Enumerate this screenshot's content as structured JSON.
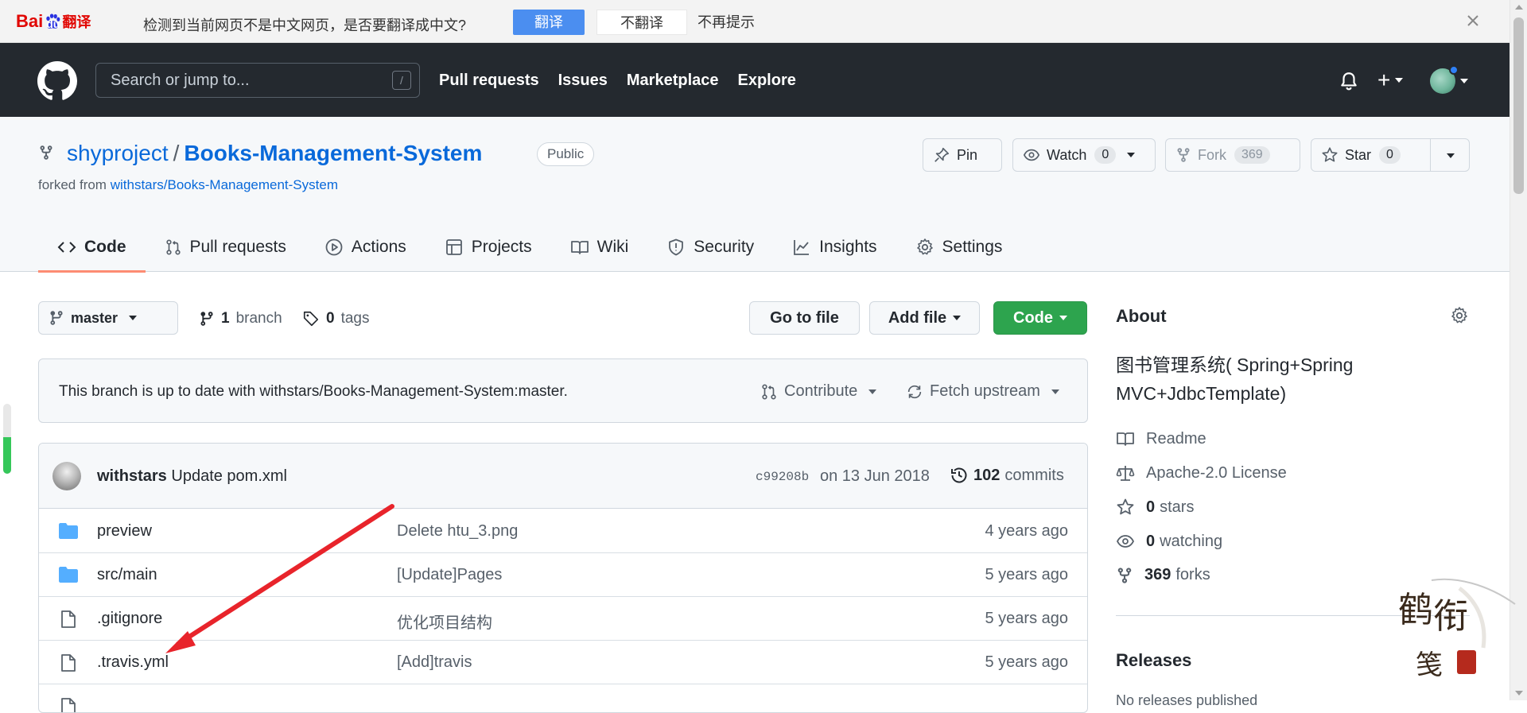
{
  "baidu_bar": {
    "logo_text": "Bai",
    "logo_text2": "du",
    "logo_suffix": "翻译",
    "message": "检测到当前网页不是中文网页，是否要翻译成中文?",
    "translate_label": "翻译",
    "no_translate_label": "不翻译",
    "never_label": "不再提示",
    "accent_color": "#4b8ef0",
    "brand_color": "#e10602"
  },
  "github_header": {
    "search_placeholder": "Search or jump to...",
    "search_shortcut": "/",
    "nav": [
      "Pull requests",
      "Issues",
      "Marketplace",
      "Explore"
    ],
    "plus_label": "+",
    "background_color": "#24292f"
  },
  "repo": {
    "owner": "shyproject",
    "separator": "/",
    "name": "Books-Management-System",
    "visibility": "Public",
    "forked_prefix": "forked from",
    "forked_from": "withstars/Books-Management-System",
    "pin_label": "Pin",
    "watch_label": "Watch",
    "watch_count": "0",
    "fork_label": "Fork",
    "fork_count": "369",
    "star_label": "Star",
    "star_count": "0"
  },
  "tabs": [
    {
      "label": "Code",
      "icon": "code-icon",
      "active": true
    },
    {
      "label": "Pull requests",
      "icon": "pull-request-icon",
      "active": false
    },
    {
      "label": "Actions",
      "icon": "play-icon",
      "active": false
    },
    {
      "label": "Projects",
      "icon": "table-icon",
      "active": false
    },
    {
      "label": "Wiki",
      "icon": "book-icon",
      "active": false
    },
    {
      "label": "Security",
      "icon": "shield-icon",
      "active": false
    },
    {
      "label": "Insights",
      "icon": "graph-icon",
      "active": false
    },
    {
      "label": "Settings",
      "icon": "gear-icon",
      "active": false
    }
  ],
  "toolbar": {
    "branch": "master",
    "branch_count": "1",
    "branch_word": "branch",
    "tag_count": "0",
    "tag_word": "tags",
    "go_to_file": "Go to file",
    "add_file": "Add file",
    "code": "Code",
    "code_color": "#2da44e"
  },
  "sync_notice": {
    "message": "This branch is up to date with withstars/Books-Management-System:master.",
    "contribute": "Contribute",
    "fetch": "Fetch upstream"
  },
  "latest_commit": {
    "author": "withstars",
    "message": "Update pom.xml",
    "hash": "c99208b",
    "date": "on 13 Jun 2018",
    "count": "102",
    "count_word": "commits"
  },
  "files": [
    {
      "type": "folder",
      "name": "preview",
      "message": "Delete htu_3.png",
      "age": "4 years ago"
    },
    {
      "type": "folder",
      "name": "src/main",
      "message": "[Update]Pages",
      "age": "5 years ago"
    },
    {
      "type": "file",
      "name": ".gitignore",
      "message": "优化项目结构",
      "age": "5 years ago"
    },
    {
      "type": "file",
      "name": ".travis.yml",
      "message": "[Add]travis",
      "age": "5 years ago"
    }
  ],
  "about": {
    "title": "About",
    "description": "图书管理系统( Spring+Spring MVC+JdbcTemplate)",
    "readme": "Readme",
    "license": "Apache-2.0 License",
    "stars_count": "0",
    "stars_word": "stars",
    "watching_count": "0",
    "watching_word": "watching",
    "forks_count": "369",
    "forks_word": "forks"
  },
  "releases": {
    "title": "Releases",
    "subtitle": "No releases published"
  },
  "side_indicator": {
    "level": 0.52
  },
  "annotation": {
    "arrow_color": "#e8242b"
  },
  "watermark": {
    "text": "鹤衔笺"
  }
}
